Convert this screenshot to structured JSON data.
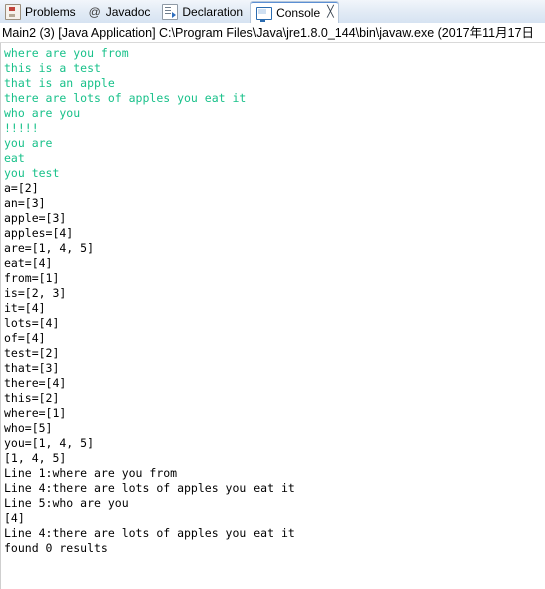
{
  "window": {
    "title": "Console"
  },
  "tabs": [
    {
      "id": "problems",
      "label": "Problems",
      "icon": "problems-icon",
      "active": false,
      "closable": false
    },
    {
      "id": "javadoc",
      "label": "Javadoc",
      "icon": "at-sign-icon",
      "active": false,
      "closable": false
    },
    {
      "id": "declaration",
      "label": "Declaration",
      "icon": "declaration-icon",
      "active": false,
      "closable": false
    },
    {
      "id": "console",
      "label": "Console",
      "icon": "console-icon",
      "active": true,
      "closable": true,
      "close_glyph": "╳"
    }
  ],
  "console": {
    "header": "Main2 (3) [Java Application] C:\\Program Files\\Java\\jre1.8.0_144\\bin\\javaw.exe (2017年11月17日",
    "colors": {
      "stdout_green": "#19c18a",
      "stdout_black": "#000000",
      "background": "#ffffff"
    },
    "lines": [
      {
        "text": "where are you from",
        "color": "green"
      },
      {
        "text": "this is a test",
        "color": "green"
      },
      {
        "text": "that is an apple",
        "color": "green"
      },
      {
        "text": "there are lots of apples you eat it",
        "color": "green"
      },
      {
        "text": "who are you",
        "color": "green"
      },
      {
        "text": "!!!!!",
        "color": "green"
      },
      {
        "text": "you are",
        "color": "green"
      },
      {
        "text": "eat",
        "color": "green"
      },
      {
        "text": "you test",
        "color": "green"
      },
      {
        "text": "a=[2]",
        "color": "black"
      },
      {
        "text": "an=[3]",
        "color": "black"
      },
      {
        "text": "apple=[3]",
        "color": "black"
      },
      {
        "text": "apples=[4]",
        "color": "black"
      },
      {
        "text": "are=[1, 4, 5]",
        "color": "black"
      },
      {
        "text": "eat=[4]",
        "color": "black"
      },
      {
        "text": "from=[1]",
        "color": "black"
      },
      {
        "text": "is=[2, 3]",
        "color": "black"
      },
      {
        "text": "it=[4]",
        "color": "black"
      },
      {
        "text": "lots=[4]",
        "color": "black"
      },
      {
        "text": "of=[4]",
        "color": "black"
      },
      {
        "text": "test=[2]",
        "color": "black"
      },
      {
        "text": "that=[3]",
        "color": "black"
      },
      {
        "text": "there=[4]",
        "color": "black"
      },
      {
        "text": "this=[2]",
        "color": "black"
      },
      {
        "text": "where=[1]",
        "color": "black"
      },
      {
        "text": "who=[5]",
        "color": "black"
      },
      {
        "text": "you=[1, 4, 5]",
        "color": "black"
      },
      {
        "text": "[1, 4, 5]",
        "color": "black"
      },
      {
        "text": "Line 1:where are you from",
        "color": "black"
      },
      {
        "text": "Line 4:there are lots of apples you eat it",
        "color": "black"
      },
      {
        "text": "Line 5:who are you",
        "color": "black"
      },
      {
        "text": "[4]",
        "color": "black"
      },
      {
        "text": "Line 4:there are lots of apples you eat it",
        "color": "black"
      },
      {
        "text": "found 0 results",
        "color": "black"
      }
    ]
  }
}
